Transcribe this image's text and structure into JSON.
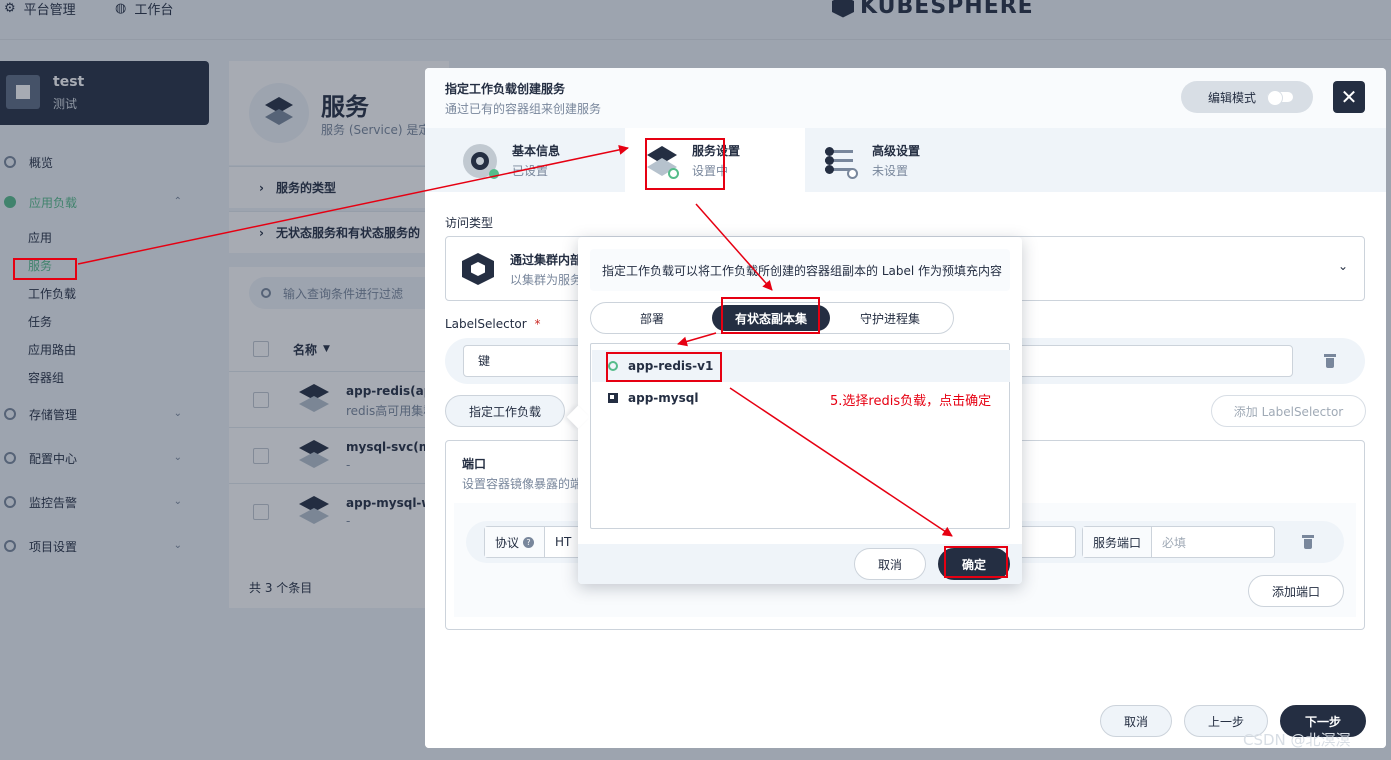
{
  "topbar": {
    "platform": "平台管理",
    "workbench": "工作台",
    "logo": "KUBESPHERE"
  },
  "project": {
    "name": "test",
    "desc": "测试"
  },
  "sidebar": {
    "items": [
      {
        "label": "概览"
      },
      {
        "label": "应用负载"
      },
      {
        "label": "存储管理"
      },
      {
        "label": "配置中心"
      },
      {
        "label": "监控告警"
      },
      {
        "label": "项目设置"
      }
    ],
    "sub": [
      {
        "label": "应用"
      },
      {
        "label": "服务"
      },
      {
        "label": "工作负载"
      },
      {
        "label": "任务"
      },
      {
        "label": "应用路由"
      },
      {
        "label": "容器组"
      }
    ]
  },
  "services_page": {
    "title": "服务",
    "subtitle": "服务 (Service) 是定",
    "section_types": "服务的类型",
    "section_stateless": "无状态服务和有状态服务的",
    "search_placeholder": "输入查询条件进行过滤",
    "col_name": "名称",
    "rows": [
      {
        "name": "app-redis(app-",
        "desc": "redis高可用集群"
      },
      {
        "name": "mysql-svc(mys",
        "desc": "-"
      },
      {
        "name": "app-mysql-wy",
        "desc": "-"
      }
    ],
    "total": "共 3 个条目"
  },
  "modal": {
    "title": "指定工作负载创建服务",
    "subtitle": "通过已有的容器组来创建服务",
    "edit_mode": "编辑模式",
    "close": "✕",
    "steps": [
      {
        "title": "基本信息",
        "status": "已设置"
      },
      {
        "title": "服务设置",
        "status": "设置中"
      },
      {
        "title": "高级设置",
        "status": "未设置"
      }
    ],
    "access_type_label": "访问类型",
    "access_title": "通过集群内部",
    "access_desc": "以集群为服务",
    "label_selector_label": "LabelSelector",
    "required_mark": "*",
    "key_placeholder": "键",
    "specify_workload": "指定工作负载",
    "add_label_selector": "添加 LabelSelector",
    "ports_title": "端口",
    "ports_desc": "设置容器镜像暴露的端",
    "protocol_label": "协议",
    "protocol_value": "HT",
    "service_port_label": "服务端口",
    "service_port_placeholder": "必填",
    "add_port": "添加端口",
    "cancel": "取消",
    "prev": "上一步",
    "next": "下一步"
  },
  "popover": {
    "hint": "指定工作负载可以将工作负载所创建的容器组副本的 Label 作为预填充内容",
    "tabs": [
      {
        "label": "部署"
      },
      {
        "label": "有状态副本集"
      },
      {
        "label": "守护进程集"
      }
    ],
    "workloads": [
      {
        "name": "app-redis-v1"
      },
      {
        "name": "app-mysql"
      }
    ],
    "cancel": "取消",
    "confirm": "确定"
  },
  "annotation": {
    "text": "5.选择redis负载，点击确定",
    "color": "#e60012"
  },
  "watermark": "CSDN @北溟溟",
  "colors": {
    "dark": "#242e42",
    "accent_green": "#55bc8a",
    "bg": "#eff4f9"
  }
}
